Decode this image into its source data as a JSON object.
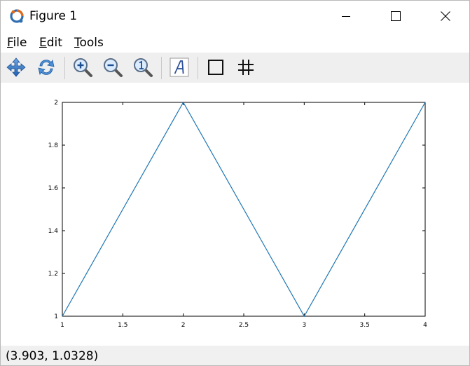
{
  "window": {
    "title": "Figure 1"
  },
  "menu": {
    "file": {
      "accel": "F",
      "rest": "ile"
    },
    "edit": {
      "accel": "E",
      "rest": "dit"
    },
    "tools": {
      "accel": "T",
      "rest": "ools"
    }
  },
  "toolbar": {
    "tools": [
      "pan-icon",
      "rotate-icon",
      "zoom-in-icon",
      "zoom-out-icon",
      "zoom-reset-icon",
      "text-icon",
      "axes-box-icon",
      "grid-icon"
    ]
  },
  "status": {
    "coordinates": "(3.903, 1.0328)"
  },
  "colors": {
    "line": "#1f77b4",
    "toolbar_bg": "#efefef",
    "status_bg": "#f0f0f0"
  },
  "chart_data": {
    "type": "line",
    "title": "",
    "xlabel": "",
    "ylabel": "",
    "xlim": [
      1,
      4
    ],
    "ylim": [
      1,
      2
    ],
    "x_ticks": [
      "1",
      "1.5",
      "2",
      "2.5",
      "3",
      "3.5",
      "4"
    ],
    "y_ticks": [
      "1",
      "1.2",
      "1.4",
      "1.6",
      "1.8",
      "2"
    ],
    "x_tick_values": [
      1,
      1.5,
      2,
      2.5,
      3,
      3.5,
      4
    ],
    "y_tick_values": [
      1,
      1.2,
      1.4,
      1.6,
      1.8,
      2
    ],
    "grid": false,
    "box": true,
    "series": [
      {
        "x": [
          1,
          2,
          3,
          4
        ],
        "values": [
          1,
          2,
          1,
          2
        ]
      }
    ]
  }
}
